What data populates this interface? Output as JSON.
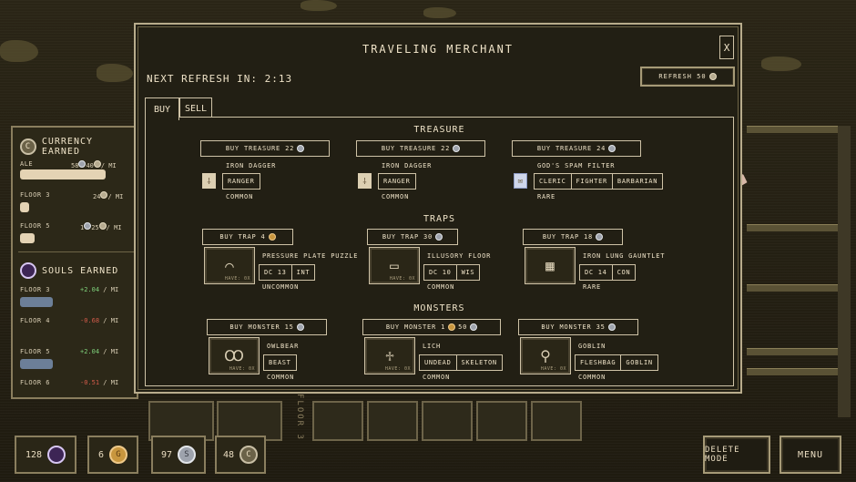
{
  "modal": {
    "title": "TRAVELING MERCHANT",
    "close_label": "x",
    "refresh_timer": "NEXT REFRESH IN: 2:13",
    "refresh_button": "REFRESH 50",
    "tabs": [
      {
        "label": "BUY",
        "active": true
      },
      {
        "label": "SELL",
        "active": false
      }
    ],
    "sections": {
      "treasure": {
        "title": "TREASURE",
        "items": [
          {
            "buy_label": "BUY TREASURE 22",
            "coin": "silver",
            "icon": "dagger-icon",
            "name": "IRON DAGGER",
            "tags": [
              "RANGER"
            ],
            "rarity": "COMMON"
          },
          {
            "buy_label": "BUY TREASURE 22",
            "coin": "silver",
            "icon": "dagger-icon",
            "name": "IRON DAGGER",
            "tags": [
              "RANGER"
            ],
            "rarity": "COMMON"
          },
          {
            "buy_label": "BUY TREASURE 24",
            "coin": "silver",
            "icon": "envelope-icon",
            "name": "GOD'S SPAM FILTER",
            "tags": [
              "CLERIC",
              "FIGHTER",
              "BARBARIAN"
            ],
            "rarity": "RARE"
          }
        ]
      },
      "traps": {
        "title": "TRAPS",
        "items": [
          {
            "buy_label": "BUY TRAP 4",
            "coin": "gold",
            "icon": "pressure-plate-icon",
            "name": "PRESSURE PLATE PUZZLE",
            "tags": [
              "DC 13",
              "INT"
            ],
            "rarity": "UNCOMMON",
            "hint": "HAVE: 0X"
          },
          {
            "buy_label": "BUY TRAP 30",
            "coin": "silver",
            "icon": "illusory-floor-icon",
            "name": "ILLUSORY FLOOR",
            "tags": [
              "DC 10",
              "WIS"
            ],
            "rarity": "COMMON",
            "hint": "HAVE: 0X"
          },
          {
            "buy_label": "BUY TRAP 18",
            "coin": "silver",
            "icon": "gauntlet-icon",
            "name": "IRON LUNG GAUNTLET",
            "tags": [
              "DC 14",
              "CON"
            ],
            "rarity": "RARE",
            "hint": ""
          }
        ]
      },
      "monsters": {
        "title": "MONSTERS",
        "items": [
          {
            "buy_label": "BUY MONSTER 15",
            "coin": "silver",
            "icon": "owlbear-icon",
            "name": "OWLBEAR",
            "tags": [
              "BEAST"
            ],
            "rarity": "COMMON",
            "hint": "HAVE: 0X"
          },
          {
            "buy_label": "BUY MONSTER 1",
            "buy_label_2": "50",
            "coin": "gold",
            "icon": "lich-icon",
            "name": "LICH",
            "tags": [
              "UNDEAD",
              "SKELETON"
            ],
            "rarity": "COMMON",
            "hint": "HAVE: 0X"
          },
          {
            "buy_label": "BUY MONSTER 35",
            "coin": "silver",
            "icon": "goblin-icon",
            "name": "GOBLIN",
            "tags": [
              "FLESHBAG",
              "GOBLIN"
            ],
            "rarity": "COMMON",
            "hint": "HAVE: 0X"
          }
        ]
      }
    }
  },
  "side_panel": {
    "currency": {
      "title": "CURRENCY EARNED",
      "rows": [
        {
          "label": "ALE",
          "value": "58",
          "value2": "40",
          "rate": "/ MI"
        },
        {
          "label": "FLOOR 3",
          "value": "24",
          "rate": "/ MI"
        },
        {
          "label": "FLOOR 5",
          "value": "1",
          "value2": "25",
          "rate": "/ MI"
        }
      ]
    },
    "souls": {
      "title": "SOULS EARNED",
      "rows": [
        {
          "label": "FLOOR 3",
          "value": "+2.04",
          "rate": "/ MI",
          "sign": "pos"
        },
        {
          "label": "FLOOR 4",
          "value": "-0.68",
          "rate": "/ MI",
          "sign": "neg"
        },
        {
          "label": "FLOOR 5",
          "value": "+2.04",
          "rate": "/ MI",
          "sign": "pos"
        },
        {
          "label": "FLOOR 6",
          "value": "-0.51",
          "rate": "/ MI",
          "sign": "neg"
        }
      ]
    }
  },
  "bottom_bar": {
    "souls_count": "128",
    "gold_count": "6",
    "silver_count": "97",
    "copper_count": "48",
    "delete_mode": "DELETE MODE",
    "menu": "MENU",
    "floor_label": "FLOOR 3"
  },
  "colors": {
    "accent": "#cfc3a7",
    "background": "#221f14",
    "positive": "#7ed07a",
    "negative": "#d25b4a"
  }
}
